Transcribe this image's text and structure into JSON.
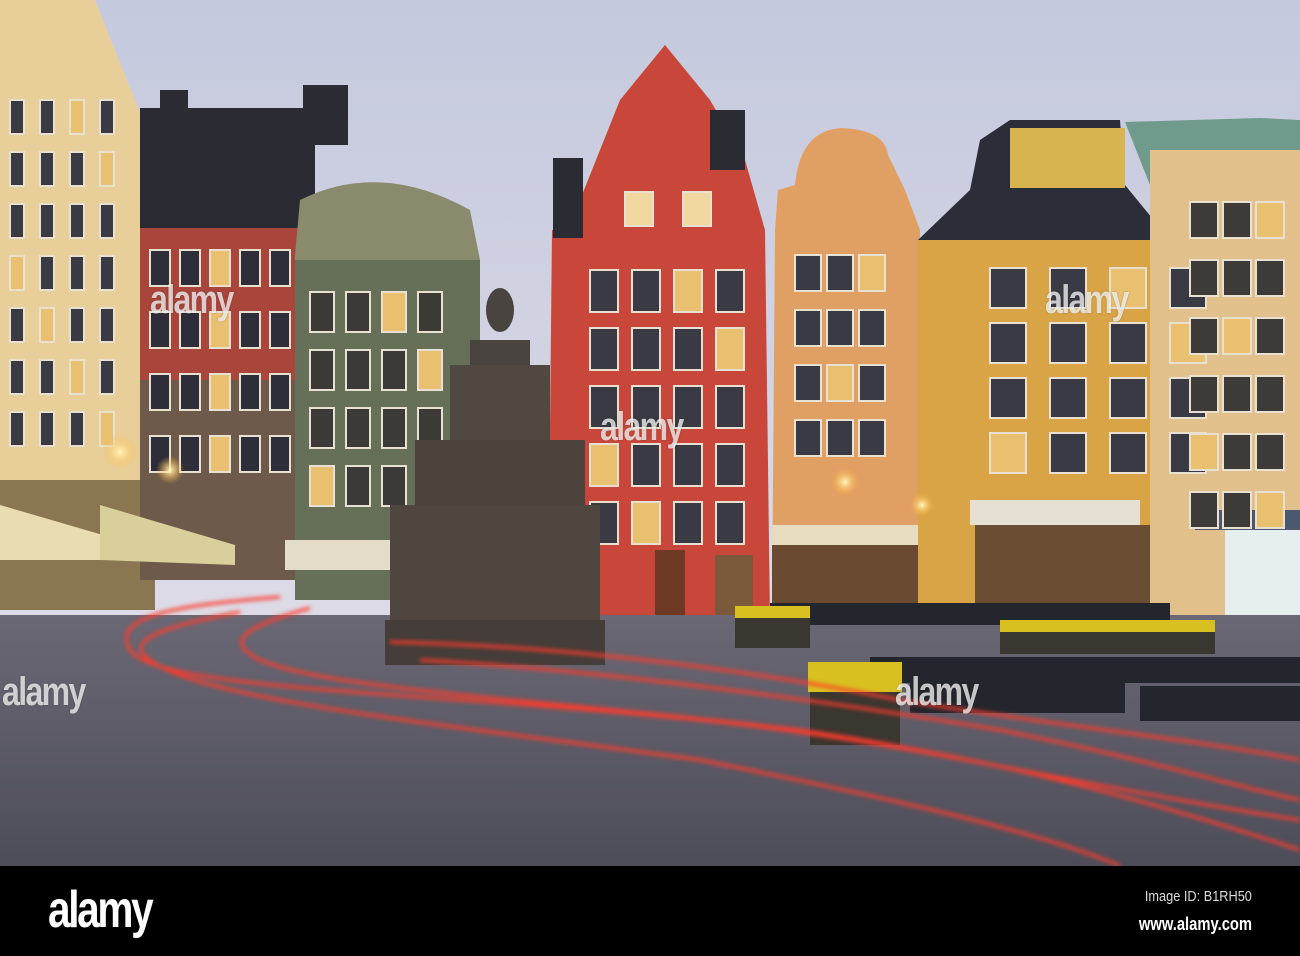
{
  "watermark": {
    "text": "alamy"
  },
  "footer": {
    "logo": "alamy",
    "image_id": "Image ID: B1RH50",
    "url": "www.alamy.com"
  },
  "colors": {
    "sky": "#cfd3e3",
    "red_building": "#c8473a",
    "orange_building": "#e0995a",
    "yellow_building": "#d9a44a",
    "green_building": "#6b7358",
    "cream_building": "#e2c08a",
    "cobblestone": "#5b5b68",
    "light_trail": "#ff3a2a"
  }
}
